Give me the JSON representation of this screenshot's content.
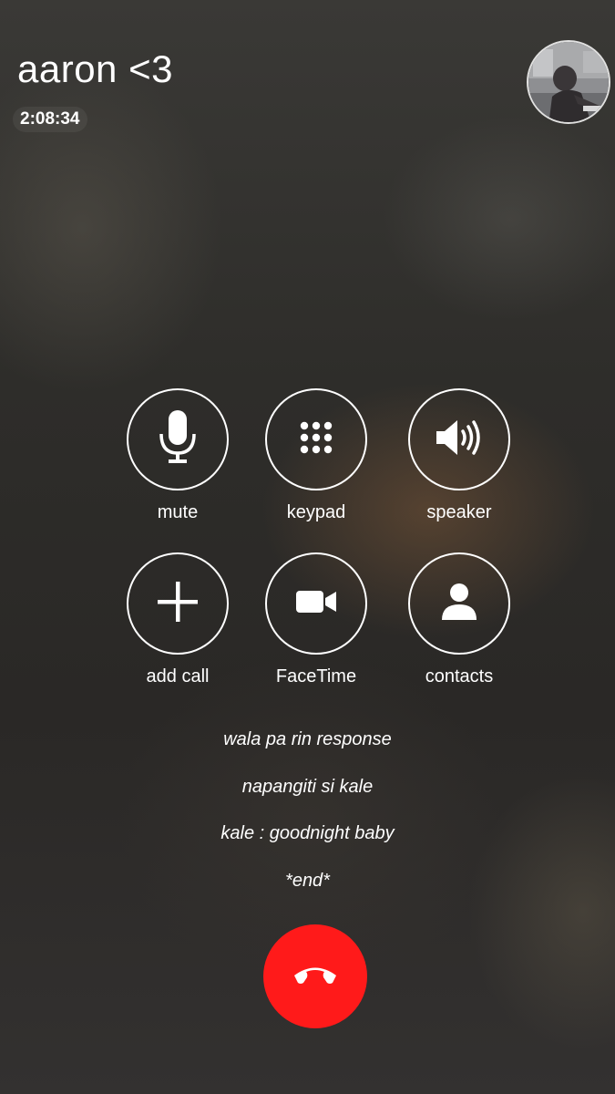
{
  "call": {
    "caller_name": "aaron <3",
    "duration": "2:08:34"
  },
  "controls": [
    {
      "label": "mute",
      "icon": "microphone-icon"
    },
    {
      "label": "keypad",
      "icon": "keypad-icon"
    },
    {
      "label": "speaker",
      "icon": "speaker-icon"
    },
    {
      "label": "add call",
      "icon": "plus-icon"
    },
    {
      "label": "FaceTime",
      "icon": "video-camera-icon"
    },
    {
      "label": "contacts",
      "icon": "person-icon"
    }
  ],
  "status_lines": [
    "wala pa rin response",
    "napangiti si kale",
    "kale : goodnight baby",
    "*end*"
  ],
  "end_call": {
    "icon": "phone-hangup-icon",
    "color": "#ff1a1a"
  }
}
